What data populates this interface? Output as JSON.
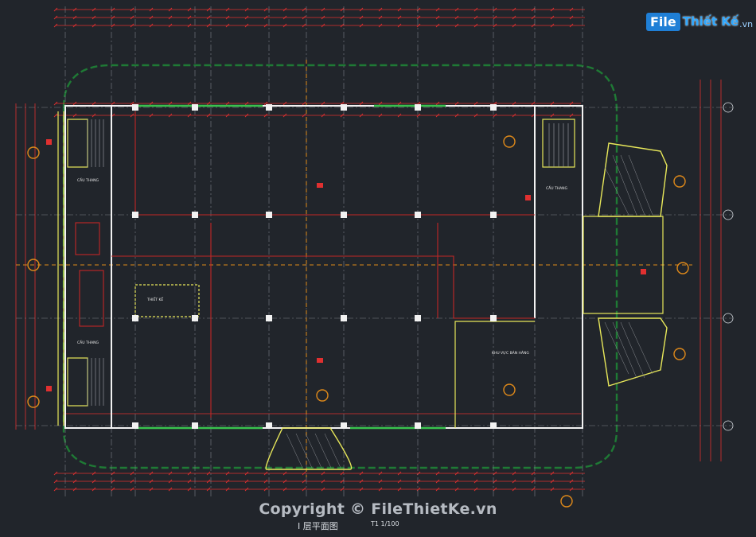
{
  "logo": {
    "part1": "File",
    "part2": "Thiết Kế",
    "part3": ".vn"
  },
  "watermark": "Copyright © FileThietKe.vn",
  "drawing_title": "I 层平面图",
  "drawing_scale": "T1 1/100",
  "room_labels": {
    "stair_nw": "CẦU THANG",
    "stair_sw": "CẦU THANG",
    "stair_ne": "CẦU THANG",
    "mid_note": "THIẾT KẾ",
    "east_hall": "KHU VỰC BÁN HÀNG"
  },
  "colors": {
    "background": "#21252b",
    "wall_white": "#f2f2f2",
    "dim_red": "#e03030",
    "grid_red": "#c22626",
    "yellow": "#e8e85a",
    "landscape_green": "#1f7a35",
    "grid_orange": "#e08a1a",
    "room_cyan": "#49b7d8"
  }
}
